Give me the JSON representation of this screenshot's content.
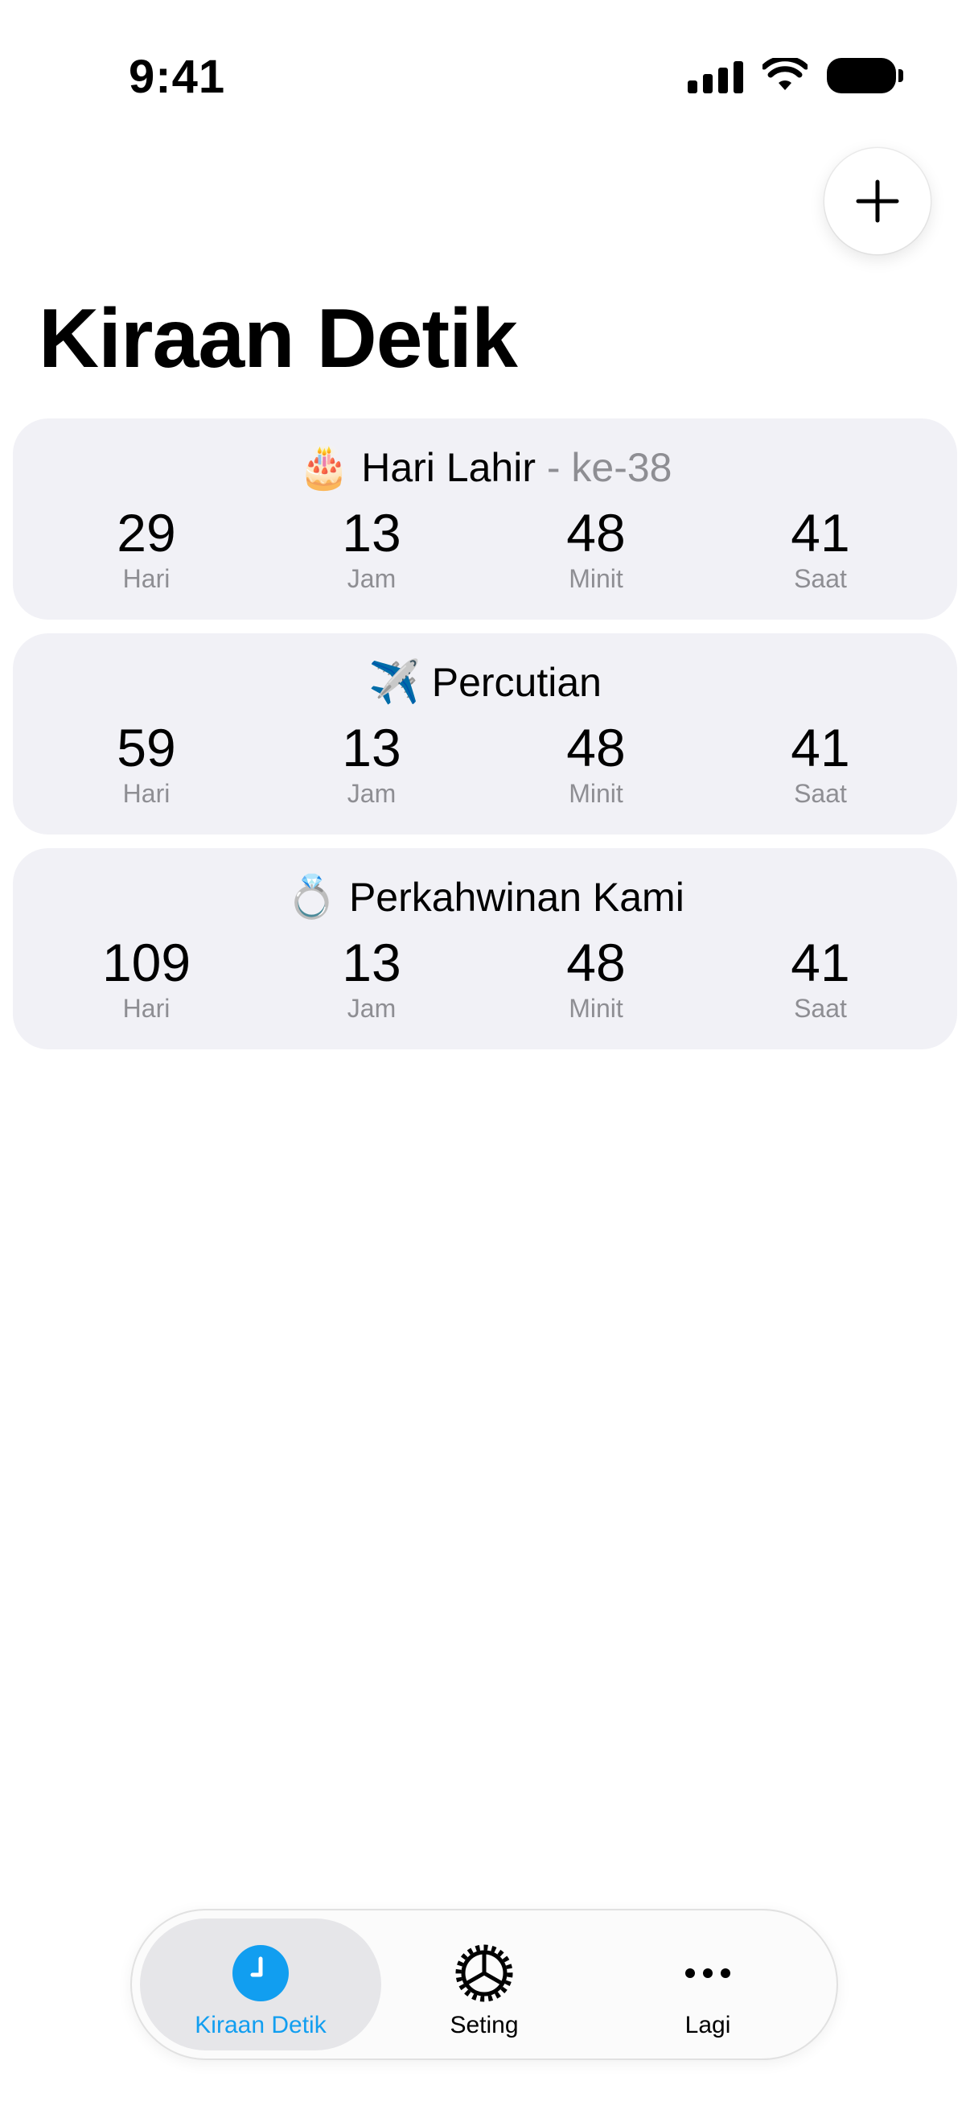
{
  "status_bar": {
    "time": "9:41"
  },
  "header": {
    "title": "Kiraan Detik",
    "add_icon": "plus-icon"
  },
  "countdowns": [
    {
      "emoji": "🎂",
      "emoji_name": "birthday-cake-icon",
      "title": "Hari Lahir",
      "suffix": " - ke-38",
      "values": [
        {
          "num": "29",
          "unit": "Hari"
        },
        {
          "num": "13",
          "unit": "Jam"
        },
        {
          "num": "48",
          "unit": "Minit"
        },
        {
          "num": "41",
          "unit": "Saat"
        }
      ]
    },
    {
      "emoji": "✈️",
      "emoji_name": "airplane-icon",
      "title": "Percutian",
      "suffix": "",
      "values": [
        {
          "num": "59",
          "unit": "Hari"
        },
        {
          "num": "13",
          "unit": "Jam"
        },
        {
          "num": "48",
          "unit": "Minit"
        },
        {
          "num": "41",
          "unit": "Saat"
        }
      ]
    },
    {
      "emoji": "💍",
      "emoji_name": "ring-icon",
      "title": "Perkahwinan Kami",
      "suffix": "",
      "values": [
        {
          "num": "109",
          "unit": "Hari"
        },
        {
          "num": "13",
          "unit": "Jam"
        },
        {
          "num": "48",
          "unit": "Minit"
        },
        {
          "num": "41",
          "unit": "Saat"
        }
      ]
    }
  ],
  "tab_bar": {
    "tabs": [
      {
        "label": "Kiraan Detik",
        "icon": "clock-icon",
        "active": true
      },
      {
        "label": "Seting",
        "icon": "gear-icon",
        "active": false
      },
      {
        "label": "Lagi",
        "icon": "more-icon",
        "active": false
      }
    ]
  },
  "colors": {
    "accent": "#119EF0",
    "card_bg": "#F1F1F6",
    "secondary_text": "#8E8E93"
  }
}
